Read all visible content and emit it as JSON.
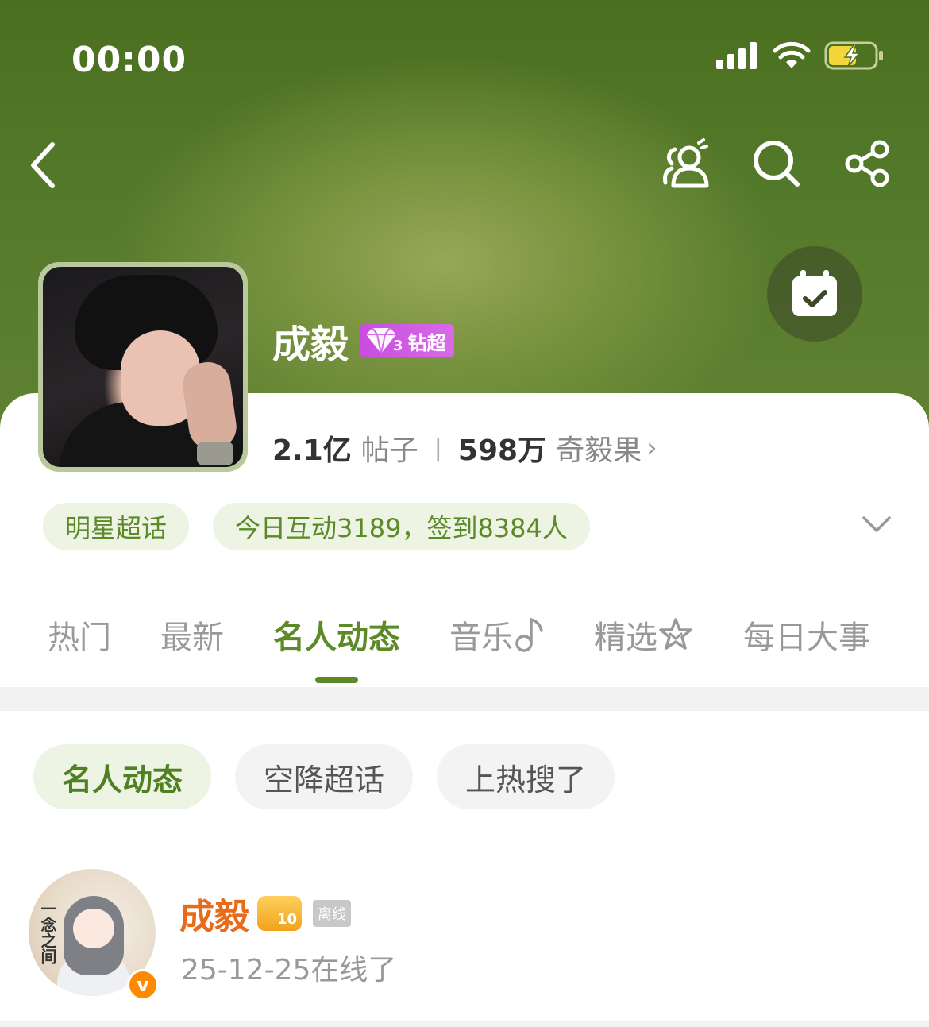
{
  "status_bar": {
    "time": "00:00"
  },
  "header": {
    "title": "成毅",
    "badge_label": "钻超",
    "badge_level": "3"
  },
  "stats": {
    "posts_count": "2.1亿",
    "posts_label": "帖子",
    "fans_count": "598万",
    "fans_label": "奇毅果"
  },
  "tags": {
    "category": "明星超话",
    "activity": "今日互动3189，签到8384人"
  },
  "tabs": [
    {
      "label": "热门"
    },
    {
      "label": "最新"
    },
    {
      "label": "名人动态"
    },
    {
      "label": "音乐"
    },
    {
      "label": "精选"
    },
    {
      "label": "每日大事"
    }
  ],
  "filters": [
    {
      "label": "名人动态"
    },
    {
      "label": "空降超话"
    },
    {
      "label": "上热搜了"
    }
  ],
  "post": {
    "author": "成毅",
    "level": "10",
    "status": "离线",
    "time_text": "25-12-25在线了",
    "avatar_caption": "一念之间",
    "v_mark": "v"
  },
  "colors": {
    "brand_green": "#5b8a26",
    "chip_green_bg": "#eef4e4",
    "author_orange": "#e86b1a",
    "diamond_purple": "#c94de0"
  },
  "icons": [
    "back-icon",
    "people-icon",
    "search-icon",
    "share-icon",
    "calendar-check-icon",
    "chevron-down-icon",
    "music-note-icon",
    "star-icon"
  ]
}
